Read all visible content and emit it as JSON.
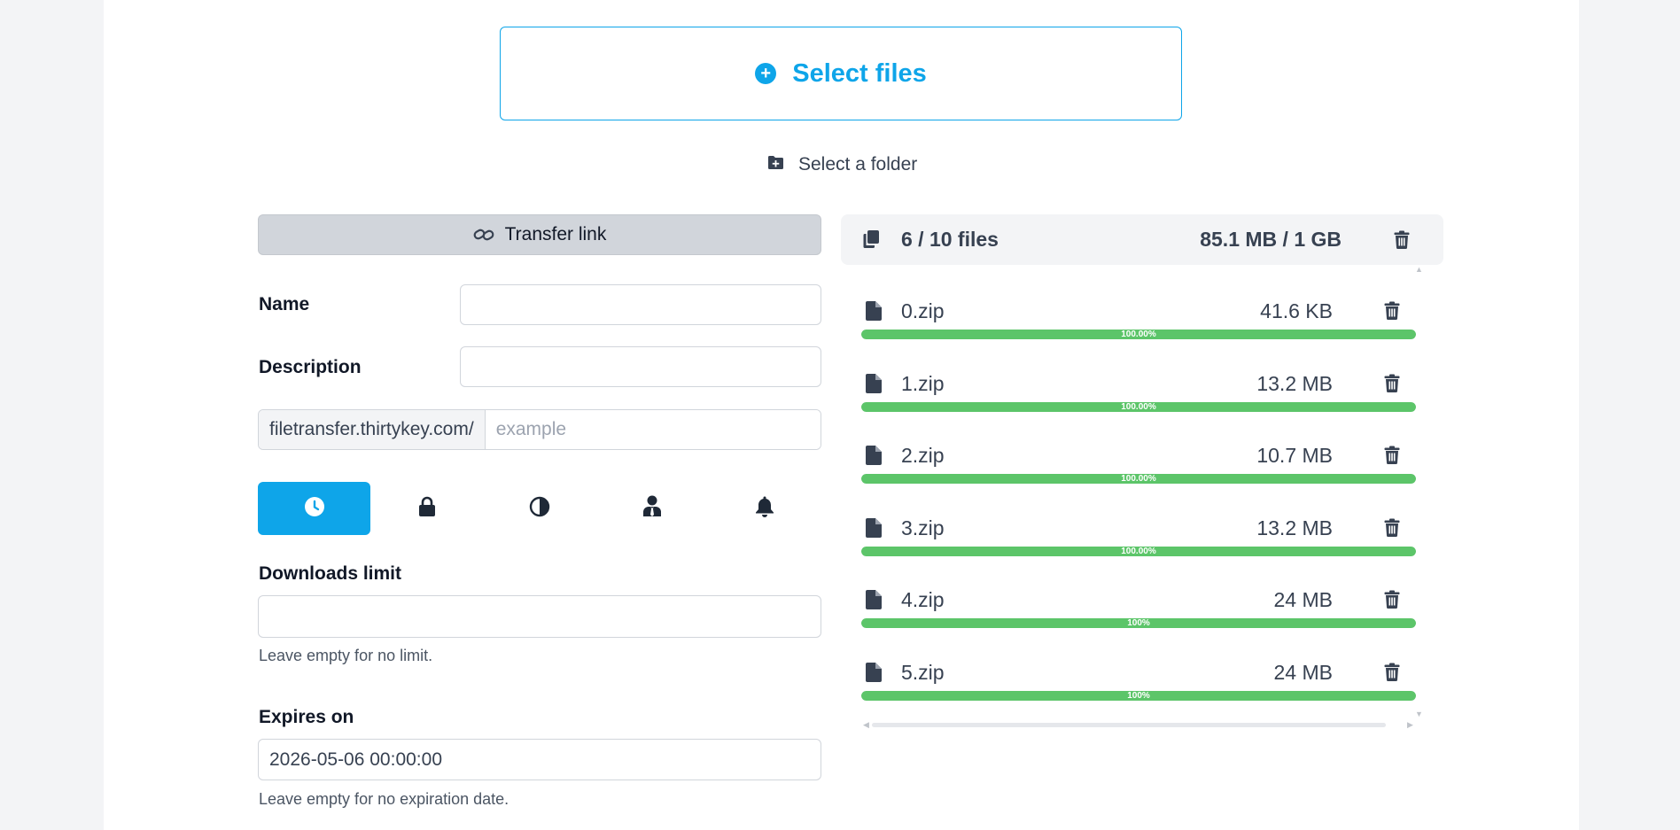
{
  "upload": {
    "select_files_label": "Select files",
    "select_folder_label": "Select a folder"
  },
  "form": {
    "transfer_link_label": "Transfer link",
    "name_label": "Name",
    "name_value": "",
    "description_label": "Description",
    "description_value": "",
    "url_prefix": "filetransfer.thirtykey.com/",
    "url_placeholder": "example",
    "option_tabs": [
      {
        "icon": "clock-icon",
        "active": true
      },
      {
        "icon": "lock-icon",
        "active": false
      },
      {
        "icon": "contrast-icon",
        "active": false
      },
      {
        "icon": "user-tie-icon",
        "active": false
      },
      {
        "icon": "bell-icon",
        "active": false
      }
    ],
    "downloads_limit_label": "Downloads limit",
    "downloads_limit_value": "",
    "downloads_limit_hint": "Leave empty for no limit.",
    "expires_on_label": "Expires on",
    "expires_on_value": "2026-05-06 00:00:00",
    "expires_on_hint": "Leave empty for no expiration date."
  },
  "files": {
    "count_label": "6 / 10 files",
    "size_label": "85.1 MB / 1 GB",
    "items": [
      {
        "name": "0.zip",
        "size": "41.6 KB",
        "progress_label": "100.00%",
        "progress": 100
      },
      {
        "name": "1.zip",
        "size": "13.2 MB",
        "progress_label": "100.00%",
        "progress": 100
      },
      {
        "name": "2.zip",
        "size": "10.7 MB",
        "progress_label": "100.00%",
        "progress": 100
      },
      {
        "name": "3.zip",
        "size": "13.2 MB",
        "progress_label": "100.00%",
        "progress": 100
      },
      {
        "name": "4.zip",
        "size": "24 MB",
        "progress_label": "100%",
        "progress": 100
      },
      {
        "name": "5.zip",
        "size": "24 MB",
        "progress_label": "100%",
        "progress": 100
      }
    ]
  },
  "colors": {
    "accent": "#0ea5e9",
    "progress": "#5cc569",
    "muted_bg": "#f3f4f6"
  }
}
